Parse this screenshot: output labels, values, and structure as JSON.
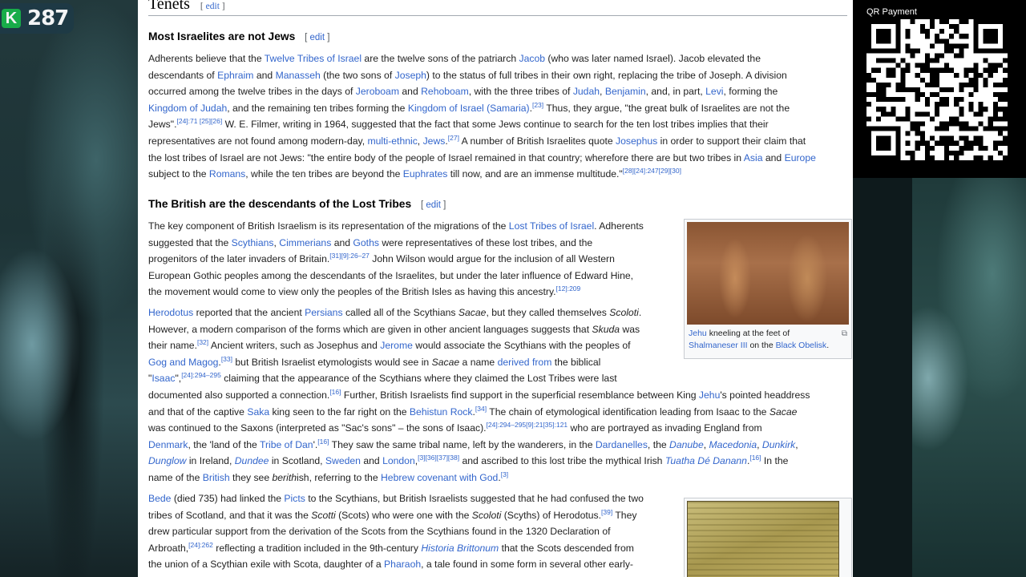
{
  "overlay": {
    "score_badge": "K",
    "score": "287",
    "qr_label": "QR Payment"
  },
  "article": {
    "edit": "edit",
    "tenets_title": "Tenets",
    "s1": {
      "title": "Most Israelites are not Jews",
      "lines": [
        [
          "Adherents believe that the ",
          {
            "a": "Twelve Tribes of Israel"
          },
          " are the twelve sons of the patriarch ",
          {
            "a": "Jacob"
          },
          " (who was later named Israel). Jacob elevated the"
        ],
        [
          "descendants of ",
          {
            "a": "Ephraim"
          },
          " and ",
          {
            "a": "Manasseh"
          },
          " (the two sons of ",
          {
            "a": "Joseph"
          },
          ") to the status of full tribes in their own right, replacing the tribe of Joseph. A division"
        ],
        [
          "occurred among the twelve tribes in the days of ",
          {
            "a": "Jeroboam"
          },
          " and ",
          {
            "a": "Rehoboam"
          },
          ", with the three tribes of ",
          {
            "a": "Judah"
          },
          ", ",
          {
            "a": "Benjamin"
          },
          ", and, in part, ",
          {
            "a": "Levi"
          },
          ", forming the"
        ],
        [
          {
            "a": "Kingdom of Judah"
          },
          ", and the remaining ten tribes forming the ",
          {
            "a": "Kingdom of Israel (Samaria)"
          },
          ".",
          {
            "s": "[23]"
          },
          " Thus, they argue, \"the great bulk of Israelites are not the"
        ],
        [
          "Jews\".",
          {
            "s": "[24]:71 [25][26]"
          },
          " W. E. Filmer, writing in 1964, suggested that the fact that some Jews continue to search for the ten lost tribes implies that their"
        ],
        [
          "representatives are not found among modern-day, ",
          {
            "a": "multi-ethnic"
          },
          ", ",
          {
            "a": "Jews"
          },
          ".",
          {
            "s": "[27]"
          },
          " A number of British Israelites quote ",
          {
            "a": "Josephus"
          },
          " in order to support their claim that"
        ],
        [
          "the lost tribes of Israel are not Jews: \"the entire body of the people of Israel remained in that country; wherefore there are but two tribes in ",
          {
            "a": "Asia"
          },
          " and ",
          {
            "a": "Europe"
          }
        ],
        [
          "subject to the ",
          {
            "a": "Romans"
          },
          ", while the ten tribes are beyond the ",
          {
            "a": "Euphrates"
          },
          " till now, and are an immense multitude.\"",
          {
            "s": "[28][24]:247[29][30]"
          }
        ]
      ]
    },
    "s2": {
      "title": "The British are the descendants of the Lost Tribes",
      "p1": [
        [
          "The key component of British Israelism is its representation of the migrations of the ",
          {
            "a": "Lost Tribes of Israel"
          },
          ". Adherents"
        ],
        [
          "suggested that the ",
          {
            "a": "Scythians"
          },
          ", ",
          {
            "a": "Cimmerians"
          },
          " and ",
          {
            "a": "Goths"
          },
          " were representatives of these lost tribes, and the"
        ],
        [
          "progenitors of the later invaders of Britain.",
          {
            "s": "[31][9]:26–27"
          },
          " John Wilson would argue for the inclusion of all Western"
        ],
        [
          "European Gothic peoples among the descendants of the Israelites, but under the later influence of Edward Hine,"
        ],
        [
          "the movement would come to view only the peoples of the British Isles as having this ancestry.",
          {
            "s": "[12]:209"
          }
        ]
      ],
      "p2": [
        [
          {
            "a": "Herodotus"
          },
          " reported that the ancient ",
          {
            "a": "Persians"
          },
          " called all of the Scythians ",
          {
            "i": "Sacae"
          },
          ", but they called themselves ",
          {
            "i": "Scoloti"
          },
          "."
        ],
        [
          "However, a modern comparison of the forms which are given in other ancient languages suggests that ",
          {
            "i": "Skuda"
          },
          " was"
        ],
        [
          "their name.",
          {
            "s": "[32]"
          },
          " Ancient writers, such as Josephus and ",
          {
            "a": "Jerome"
          },
          " would associate the Scythians with the peoples of"
        ],
        [
          {
            "a": "Gog and Magog"
          },
          ".",
          {
            "s": "[33]"
          },
          " but British Israelist etymologists would see in ",
          {
            "i": "Sacae"
          },
          " a name ",
          {
            "a": "derived from"
          },
          " the biblical"
        ],
        [
          "\"",
          {
            "a": "Isaac"
          },
          "\",",
          {
            "s": "[24]:294–295"
          },
          " claiming that the appearance of the Scythians where they claimed the Lost Tribes were last"
        ],
        [
          "documented also supported a connection.",
          {
            "s": "[16]"
          },
          " Further, British Israelists find support in the superficial resemblance between King ",
          {
            "a": "Jehu"
          },
          "'s pointed headdress"
        ],
        [
          "and that of the captive ",
          {
            "a": "Saka"
          },
          " king seen to the far right on the ",
          {
            "a": "Behistun Rock"
          },
          ".",
          {
            "s": "[34]"
          },
          " The chain of etymological identification leading from Isaac to the ",
          {
            "i": "Sacae"
          }
        ],
        [
          "was continued to the Saxons (interpreted as \"Sac's sons\" – the sons of Isaac).",
          {
            "s": "[24]:294–295[9]:21[35]:121"
          },
          " who are portrayed as invading England from"
        ],
        [
          {
            "a": "Denmark"
          },
          ", the 'land of the ",
          {
            "a": "Tribe of Dan"
          },
          "'.",
          {
            "s": "[16]"
          },
          " They saw the same tribal name, left by the wanderers, in the ",
          {
            "a": "Dardanelles"
          },
          ", the ",
          {
            "ai": "Danube"
          },
          ", ",
          {
            "ai": "Macedonia"
          },
          ", ",
          {
            "ai": "Dunkirk"
          },
          ","
        ],
        [
          {
            "ai": "Dunglow"
          },
          " in Ireland, ",
          {
            "ai": "Dundee"
          },
          " in Scotland, ",
          {
            "a": "Sweden"
          },
          " and ",
          {
            "a": "London"
          },
          ",",
          {
            "s": "[3][36][37][38]"
          },
          " and ascribed to this lost tribe the mythical Irish ",
          {
            "ai": "Tuatha Dé Danann"
          },
          ".",
          {
            "s": "[16]"
          },
          " In the"
        ],
        [
          "name of the ",
          {
            "a": "British"
          },
          " they see ",
          {
            "i": "berith"
          },
          "ish, referring to the ",
          {
            "a": "Hebrew covenant with God"
          },
          ".",
          {
            "s": "[3]"
          }
        ]
      ],
      "p3": [
        [
          {
            "a": "Bede"
          },
          " (died 735) had linked the ",
          {
            "a": "Picts"
          },
          " to the Scythians, but British Israelists suggested that he had confused the two"
        ],
        [
          "tribes of Scotland, and that it was the ",
          {
            "i": "Scotti"
          },
          " (Scots) who were one with the ",
          {
            "i": "Scoloti"
          },
          " (Scyths) of Herodotus.",
          {
            "s": "[39]"
          },
          " They"
        ],
        [
          "drew particular support from the derivation of the Scots from the Scythians found in the 1320 Declaration of"
        ],
        [
          "Arbroath,",
          {
            "s": "[24]:262"
          },
          " reflecting a tradition included in the 9th-century ",
          {
            "ai": "Historia Brittonum"
          },
          " that the Scots descended from"
        ],
        [
          "the union of a Scythian exile with Scota, daughter of a ",
          {
            "a": "Pharaoh"
          },
          ", a tale found in some form in several other early-"
        ]
      ],
      "figure1": {
        "caption": [
          {
            "a": "Jehu"
          },
          " kneeling at the feet of ",
          {
            "a": "Shalmaneser III"
          },
          " on the ",
          {
            "a": "Black Obelisk"
          },
          "."
        ]
      }
    }
  }
}
